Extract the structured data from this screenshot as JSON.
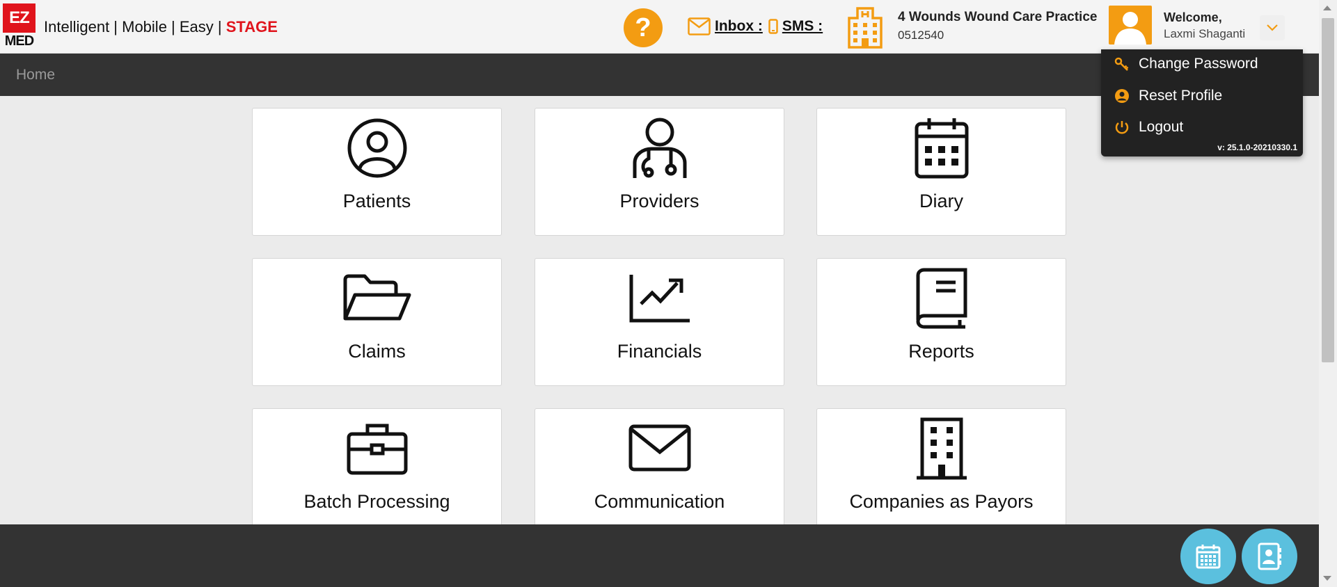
{
  "header": {
    "logo_top": "EZ",
    "logo_bottom": "MED",
    "tagline": "Intelligent | Mobile | Easy | ",
    "stage": "STAGE",
    "help_glyph": "?",
    "inbox_label": " Inbox : ",
    "sms_label": " SMS : ",
    "practice_name": "4 Wounds Wound Care Practice",
    "practice_code": "0512540"
  },
  "user": {
    "welcome": "Welcome,",
    "name": "Laxmi Shaganti"
  },
  "nav": {
    "breadcrumb": "Home"
  },
  "menu": {
    "items": [
      {
        "label": "Change Password",
        "icon": "key-icon"
      },
      {
        "label": "Reset Profile",
        "icon": "user-circle-icon"
      },
      {
        "label": "Logout",
        "icon": "power-icon"
      }
    ],
    "version": "v: 25.1.0-20210330.1"
  },
  "tiles": [
    {
      "label": "Patients",
      "icon": "user-circle-icon"
    },
    {
      "label": "Providers",
      "icon": "doctor-icon"
    },
    {
      "label": "Diary",
      "icon": "calendar-icon"
    },
    {
      "label": "Claims",
      "icon": "folder-open-icon"
    },
    {
      "label": "Financials",
      "icon": "chart-line-icon"
    },
    {
      "label": "Reports",
      "icon": "book-icon"
    },
    {
      "label": "Batch Processing",
      "icon": "briefcase-icon"
    },
    {
      "label": "Communication",
      "icon": "envelope-icon"
    },
    {
      "label": "Companies as Payors",
      "icon": "building-icon"
    }
  ],
  "footer": {
    "buttons": [
      {
        "icon": "calendar-icon"
      },
      {
        "icon": "contacts-book-icon"
      }
    ]
  },
  "colors": {
    "accent": "#f39c12",
    "brand_red": "#e0141c",
    "dark_bar": "#333333",
    "fab": "#5bc0de"
  }
}
